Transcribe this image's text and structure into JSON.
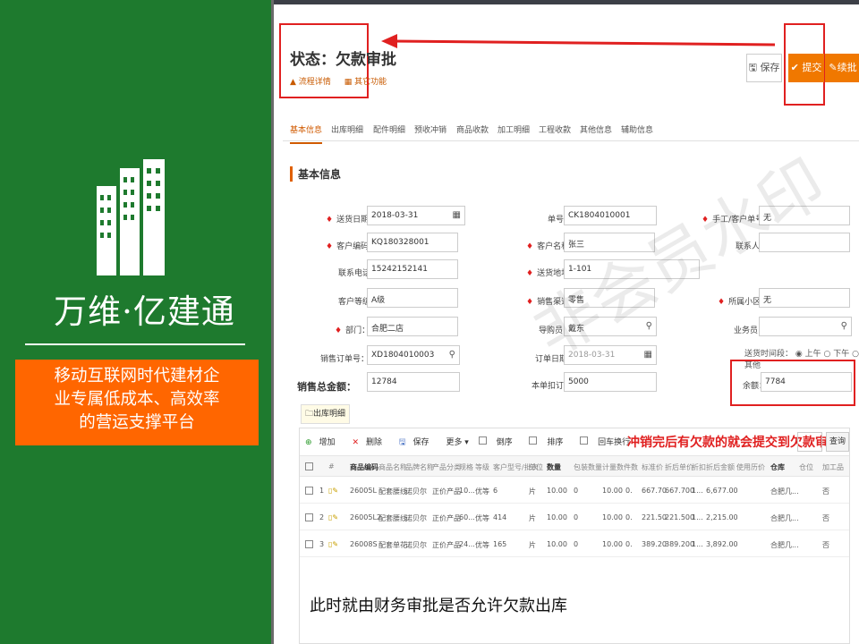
{
  "brand": {
    "name": "万维·亿建通",
    "slogan_lines": [
      "移动互联网时代建材企",
      "业专属低成本、高效率",
      "的营运支撑平台"
    ]
  },
  "header": {
    "status": "状态：欠款审批",
    "links": [
      "流程详情",
      "其它功能"
    ],
    "buttons": {
      "save": "保存",
      "submit": "提交",
      "more": "续批"
    }
  },
  "tabs": [
    "基本信息",
    "出库明细",
    "配件明细",
    "预收冲销",
    "商品收款",
    "加工明细",
    "工程收款",
    "其他信息",
    "辅助信息"
  ],
  "section_title": "基本信息",
  "form": {
    "delivery_date_label": "送货日期：",
    "delivery_date": "2018-03-31",
    "order_no_label": "单号：",
    "order_no": "CK1804010001",
    "manual_no_label": "手工/客户单号：",
    "manual_no": "无",
    "customer_code_label": "客户编码：",
    "customer_code": "KQ180328001",
    "customer_name_label": "客户名称：",
    "customer_name": "张三",
    "contact_label": "联系人：",
    "contact": "",
    "phone_label": "联系电话：",
    "phone": "15242152141",
    "address_label": "送货地址：",
    "address": "1-101",
    "level_label": "客户等级：",
    "level": "A级",
    "channel_label": "销售渠道：",
    "channel": "零售",
    "community_label": "所属小区：",
    "community": "无",
    "dept_label": "部门：",
    "dept": "合肥二店",
    "guide_label": "导购员：",
    "guide": "戴东",
    "salesman_label": "业务员：",
    "salesman": "",
    "so_no_label": "销售订单号：",
    "so_no": "XD1804010003",
    "order_date_label": "订单日期：",
    "order_date": "2018-03-31",
    "delivery_time_label": "送货时间段：",
    "delivery_time_options": [
      "上午",
      "下午",
      "其他"
    ],
    "total_label": "销售总金额：",
    "total": "12784",
    "deposit_label": "本单扣订金：",
    "deposit": "5000",
    "balance_label": "余额：",
    "balance": "7784"
  },
  "grid": {
    "subtab": "出库明细",
    "toolbar": [
      "增加",
      "删除",
      "保存",
      "更多 ▾",
      "倒序",
      "排序",
      "回车换行"
    ],
    "annotation": "冲销完后有欠款的就会提交到欠款审批",
    "search_button": "查询",
    "headers": [
      "#",
      "商品编码",
      "商品名称",
      "品牌名称",
      "产品分类",
      "规格",
      "等级",
      "客户型号/批次",
      "单位",
      "数量",
      "包装数量",
      "计量数",
      "件数",
      "标准价",
      "折后单价",
      "折扣",
      "折后金额",
      "使用历价",
      "仓库",
      "仓位",
      "加工品"
    ],
    "rows": [
      {
        "n": "1",
        "code": "26005L",
        "name": "配套腰线",
        "brand": "诺贝尔",
        "cat": "正价产品",
        "spec": "10...",
        "grade": "优等",
        "model": "6",
        "unit": "片",
        "qty": "10.00",
        "pack": "0",
        "meas": "10.00",
        "pcs": "0.",
        "std": "667.70",
        "disc_price": "667.700",
        "disc": "1...",
        "amount": "6,677.00",
        "wh": "合肥几...",
        "proc": "否"
      },
      {
        "n": "2",
        "code": "26005L2",
        "name": "配套腰线",
        "brand": "诺贝尔",
        "cat": "正价产品",
        "spec": "60...",
        "grade": "优等",
        "model": "414",
        "unit": "片",
        "qty": "10.00",
        "pack": "0",
        "meas": "10.00",
        "pcs": "0.",
        "std": "221.50",
        "disc_price": "221.500",
        "disc": "1...",
        "amount": "2,215.00",
        "wh": "合肥几...",
        "proc": "否"
      },
      {
        "n": "3",
        "code": "26008S",
        "name": "配套单花",
        "brand": "诺贝尔",
        "cat": "正价产品",
        "spec": "24...",
        "grade": "优等",
        "model": "165",
        "unit": "片",
        "qty": "10.00",
        "pack": "0",
        "meas": "10.00",
        "pcs": "0.",
        "std": "389.20",
        "disc_price": "389.200",
        "disc": "1...",
        "amount": "3,892.00",
        "wh": "合肥几...",
        "proc": "否"
      }
    ]
  },
  "note": "此时就由财务审批是否允许欠款出库",
  "watermark": "非会员水印",
  "colors": {
    "green": "#1e7a2e",
    "orange": "#ff6600",
    "red": "#e02020"
  }
}
